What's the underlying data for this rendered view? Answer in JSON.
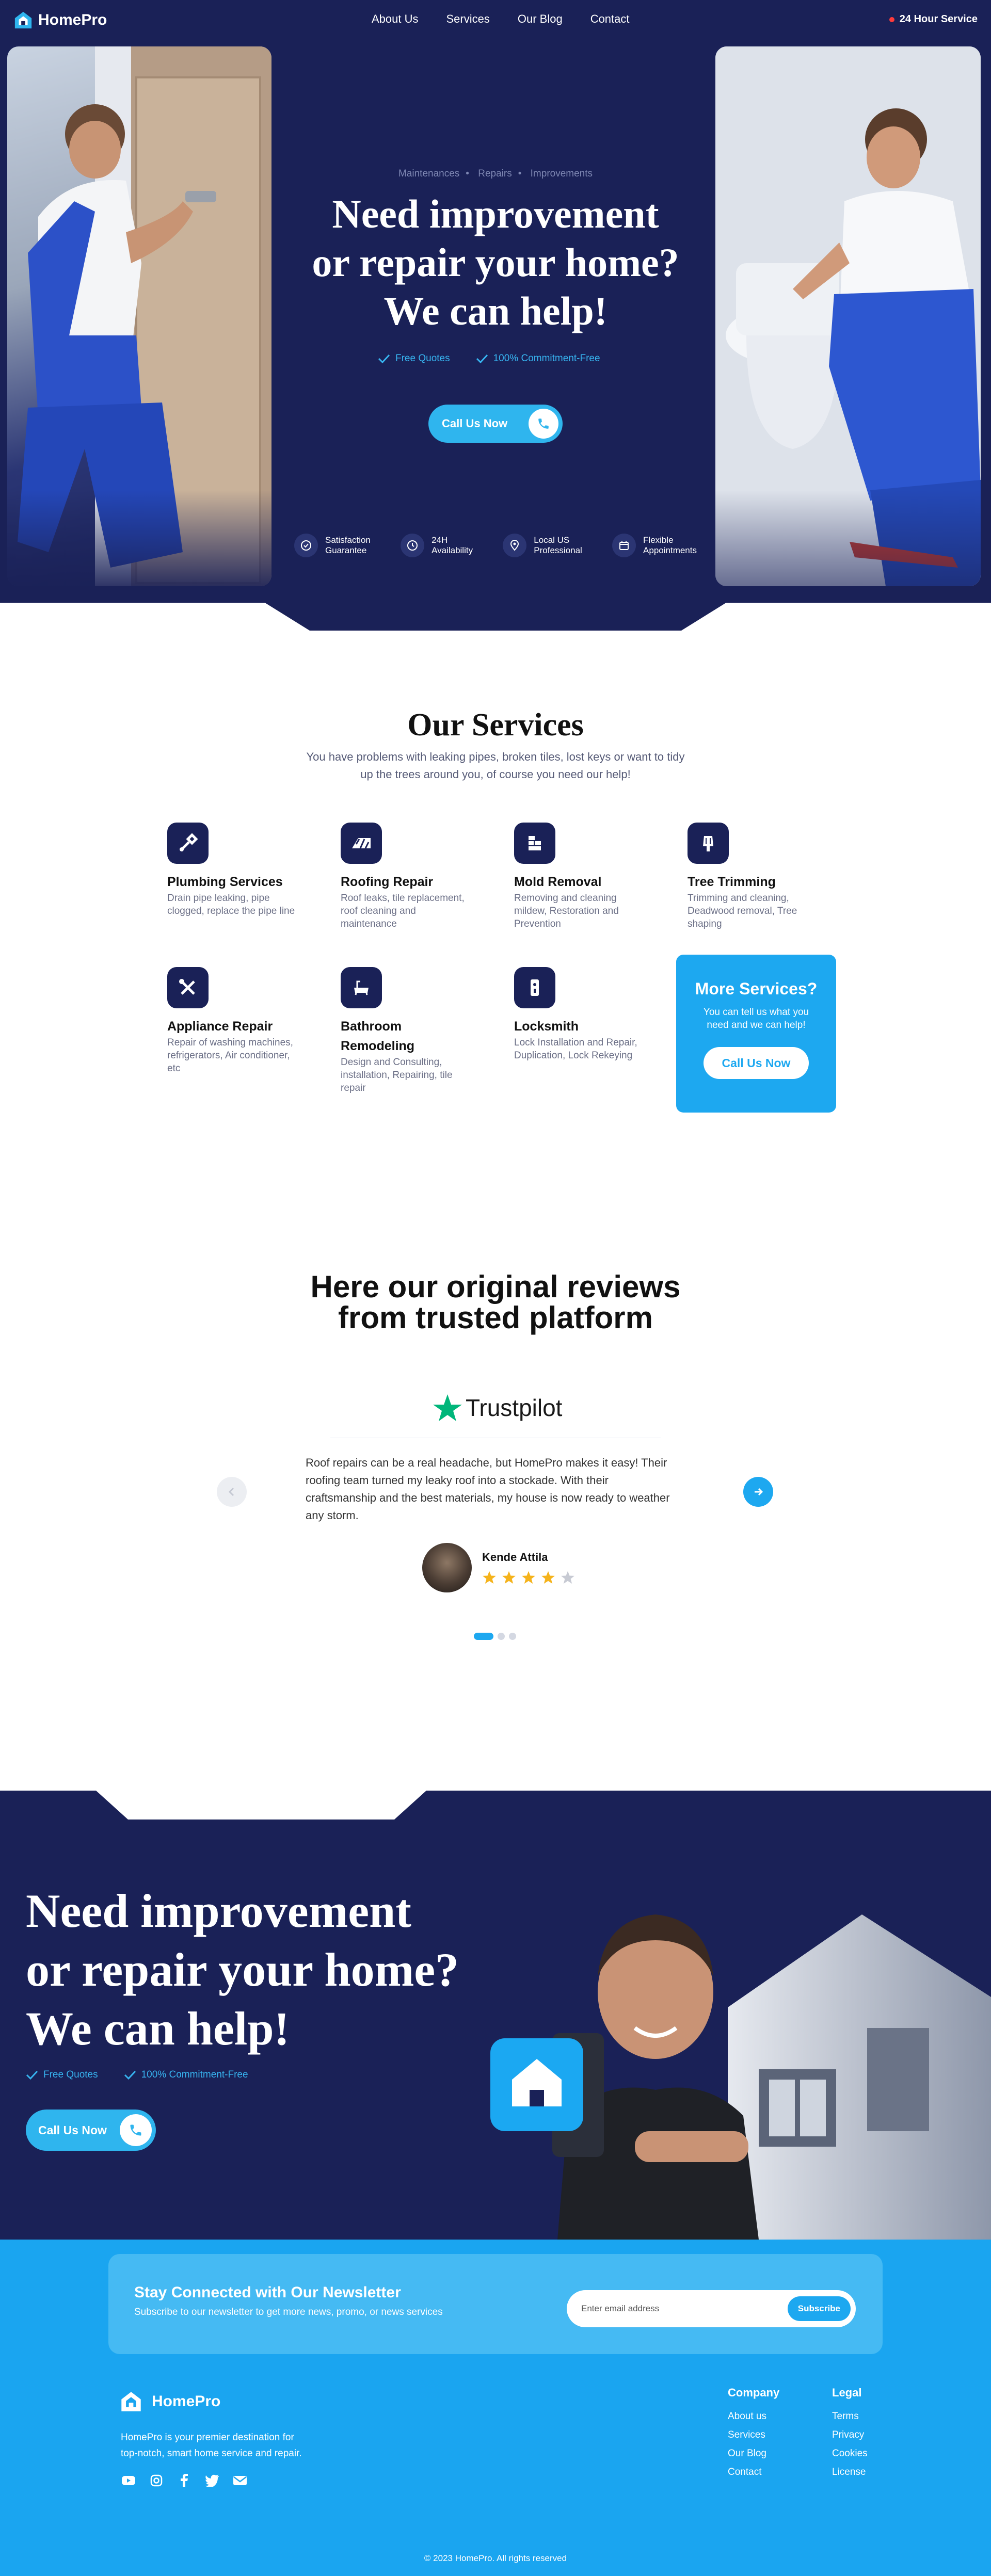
{
  "nav": {
    "brand": "HomePro",
    "links": [
      "About Us",
      "Services",
      "Our Blog",
      "Contact"
    ],
    "service_label": "24 Hour Service"
  },
  "hero": {
    "breadcrumb": [
      "Maintenances",
      "Repairs",
      "Improvements"
    ],
    "title_lines": [
      "Need improvement",
      "or repair your home?",
      "We can help!"
    ],
    "checks": [
      "Free Quotes",
      "100% Commitment-Free"
    ],
    "cta_label": "Call Us Now",
    "features": [
      {
        "line1": "Satisfaction",
        "line2": "Guarantee",
        "icon": "check-circle-icon"
      },
      {
        "line1": "24H",
        "line2": "Availability",
        "icon": "clock-icon"
      },
      {
        "line1": "Local US",
        "line2": "Professional",
        "icon": "location-pin-icon"
      },
      {
        "line1": "Flexible",
        "line2": "Appointments",
        "icon": "calendar-icon"
      }
    ]
  },
  "services": {
    "title": "Our Services",
    "subtitle_lines": [
      "You have problems with leaking pipes, broken tiles, lost keys or want to tidy",
      "up the trees around you, of course you need our help!"
    ],
    "items": [
      {
        "title_lines": [
          "Plumbing Services"
        ],
        "desc_lines": [
          "Drain pipe leaking, pipe",
          "clogged, replace the pipe line"
        ],
        "icon": "pipe-icon"
      },
      {
        "title_lines": [
          "Roofing Repair"
        ],
        "desc_lines": [
          "Roof leaks, tile replacement,",
          "roof cleaning and",
          "maintenance"
        ],
        "icon": "roof-icon"
      },
      {
        "title_lines": [
          "Mold Removal"
        ],
        "desc_lines": [
          "Removing and cleaning",
          "mildew, Restoration and",
          "Prevention"
        ],
        "icon": "bricks-icon"
      },
      {
        "title_lines": [
          "Tree Trimming"
        ],
        "desc_lines": [
          "Trimming and cleaning,",
          "Deadwood removal, Tree",
          "shaping"
        ],
        "icon": "tree-icon"
      },
      {
        "title_lines": [
          "Appliance Repair"
        ],
        "desc_lines": [
          "Repair of washing machines,",
          "refrigerators, Air conditioner,",
          "etc"
        ],
        "icon": "tools-icon"
      },
      {
        "title_lines": [
          "Bathroom",
          "Remodeling"
        ],
        "desc_lines": [
          "Design and Consulting,",
          "installation, Repairing, tile",
          "repair"
        ],
        "icon": "bathtub-icon"
      },
      {
        "title_lines": [
          "Locksmith"
        ],
        "desc_lines": [
          "Lock Installation and Repair,",
          "Duplication, Lock Rekeying"
        ],
        "icon": "lock-icon"
      }
    ],
    "more": {
      "title": "More Services?",
      "desc_lines": [
        "You can tell us what you",
        "need and we can help!"
      ],
      "button": "Call Us Now"
    }
  },
  "reviews": {
    "title_lines": [
      "Here our original reviews",
      "from trusted platform"
    ],
    "platform": "Trustpilot",
    "text_lines": [
      "Roof repairs can be a real headache, but HomePro makes it easy! Their",
      "roofing team turned my leaky roof into a stockade. With their",
      "craftsmanship and the best materials, my house is now ready to weather",
      "any storm."
    ],
    "reviewer": "Kende Attila",
    "rating": 4,
    "rating_max": 5,
    "slide_count": 3,
    "active_slide": 0
  },
  "cta2": {
    "title_lines": [
      "Need improvement",
      "or repair your home?",
      "We can help!"
    ],
    "checks": [
      "Free Quotes",
      "100% Commitment-Free"
    ],
    "cta_label": "Call Us Now"
  },
  "newsletter": {
    "title": "Stay Connected with Our Newsletter",
    "subtitle": "Subscribe to our newsletter to get more news, promo, or news services",
    "placeholder": "Enter email address",
    "button": "Subscribe"
  },
  "footer": {
    "brand": "HomePro",
    "about_lines": [
      "HomePro is your premier destination for",
      "top-notch, smart home service and repair."
    ],
    "socials": [
      "youtube-icon",
      "instagram-icon",
      "facebook-icon",
      "twitter-icon",
      "mail-icon"
    ],
    "company": {
      "heading": "Company",
      "links": [
        "About us",
        "Services",
        "Our Blog",
        "Contact"
      ]
    },
    "legal": {
      "heading": "Legal",
      "links": [
        "Terms",
        "Privacy",
        "Cookies",
        "License"
      ]
    },
    "copyright": "© 2023 HomePro. All rights reserved"
  },
  "colors": {
    "navy": "#1a2157",
    "accent": "#1da8f0",
    "star": "#f5b31b"
  }
}
